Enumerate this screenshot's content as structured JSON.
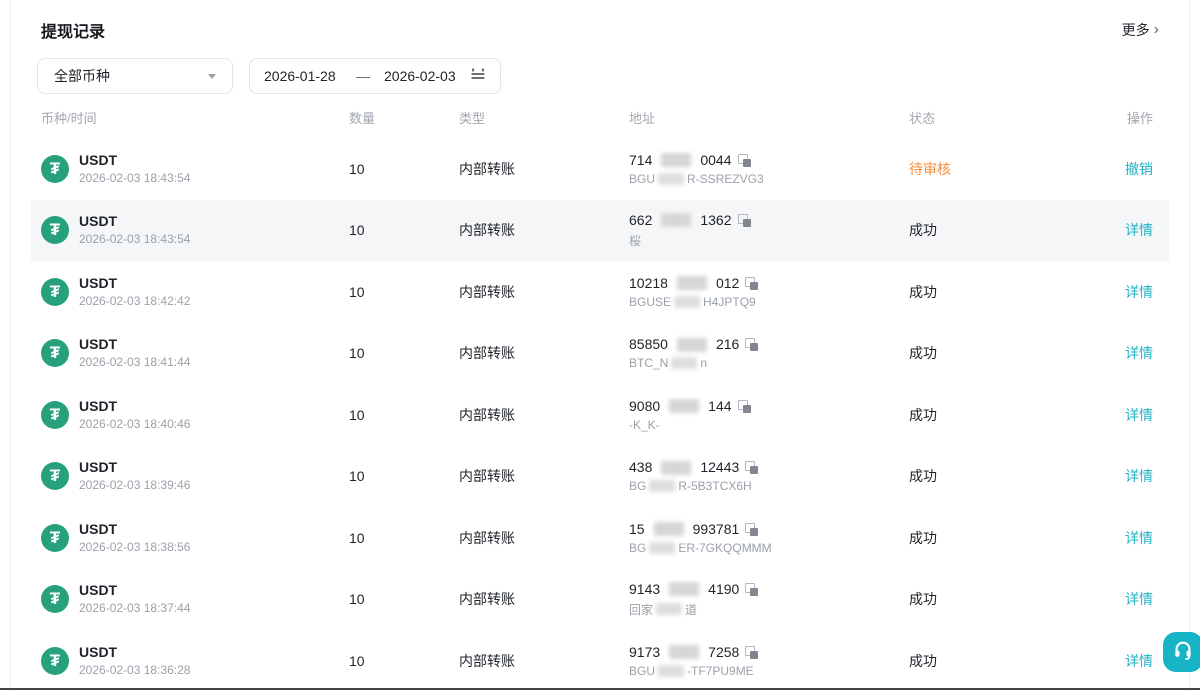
{
  "page": {
    "title": "提现记录",
    "more_label": "更多",
    "more_chevron": "›"
  },
  "filters": {
    "coin_select_value": "全部币种",
    "date_start": "2026-01-28",
    "date_separator": "—",
    "date_end": "2026-02-03"
  },
  "icons": {
    "coin": "tether-icon",
    "coin_glyph": "₮",
    "dropdown": "chevron-down-icon",
    "calendar": "calendar-icon",
    "copy": "copy-icon",
    "support": "headset-icon"
  },
  "colors": {
    "accent_teal": "#1fb3c7",
    "pending_orange": "#f78c3a",
    "tether_green": "#26a17b",
    "support_button": "#17b3c6",
    "row_highlight": "#f5f6f8"
  },
  "table": {
    "headers": [
      "币种/时间",
      "数量",
      "类型",
      "地址",
      "状态",
      "操作"
    ],
    "rows": [
      {
        "coin": "USDT",
        "time": "2026-02-03 18:43:54",
        "amount": "10",
        "type": "内部转账",
        "addr_prefix": "714",
        "addr_suffix": "0044",
        "sub_prefix": "BGU",
        "sub_suffix": "R-SSREZVG3",
        "sub_blurred": true,
        "status": "待审核",
        "status_type": "pending",
        "action": "撤销",
        "highlighted": false
      },
      {
        "coin": "USDT",
        "time": "2026-02-03 18:43:54",
        "amount": "10",
        "type": "内部转账",
        "addr_prefix": "662",
        "addr_suffix": "1362",
        "sub_prefix": "桜",
        "sub_suffix": "",
        "sub_blurred": false,
        "status": "成功",
        "status_type": "success",
        "action": "详情",
        "highlighted": true
      },
      {
        "coin": "USDT",
        "time": "2026-02-03 18:42:42",
        "amount": "10",
        "type": "内部转账",
        "addr_prefix": "10218",
        "addr_suffix": "012",
        "sub_prefix": "BGUSE",
        "sub_suffix": "H4JPTQ9",
        "sub_blurred": true,
        "status": "成功",
        "status_type": "success",
        "action": "详情",
        "highlighted": false
      },
      {
        "coin": "USDT",
        "time": "2026-02-03 18:41:44",
        "amount": "10",
        "type": "内部转账",
        "addr_prefix": "85850",
        "addr_suffix": "216",
        "sub_prefix": "BTC_N",
        "sub_suffix": "n",
        "sub_blurred": true,
        "status": "成功",
        "status_type": "success",
        "action": "详情",
        "highlighted": false
      },
      {
        "coin": "USDT",
        "time": "2026-02-03 18:40:46",
        "amount": "10",
        "type": "内部转账",
        "addr_prefix": "9080",
        "addr_suffix": "144",
        "sub_prefix": "-K_K-",
        "sub_suffix": "",
        "sub_blurred": false,
        "status": "成功",
        "status_type": "success",
        "action": "详情",
        "highlighted": false
      },
      {
        "coin": "USDT",
        "time": "2026-02-03 18:39:46",
        "amount": "10",
        "type": "内部转账",
        "addr_prefix": "438",
        "addr_suffix": "12443",
        "sub_prefix": "BG",
        "sub_suffix": "R-5B3TCX6H",
        "sub_blurred": true,
        "status": "成功",
        "status_type": "success",
        "action": "详情",
        "highlighted": false
      },
      {
        "coin": "USDT",
        "time": "2026-02-03 18:38:56",
        "amount": "10",
        "type": "内部转账",
        "addr_prefix": "15",
        "addr_suffix": "993781",
        "sub_prefix": "BG",
        "sub_suffix": "ER-7GKQQMMM",
        "sub_blurred": true,
        "status": "成功",
        "status_type": "success",
        "action": "详情",
        "highlighted": false
      },
      {
        "coin": "USDT",
        "time": "2026-02-03 18:37:44",
        "amount": "10",
        "type": "内部转账",
        "addr_prefix": "9143",
        "addr_suffix": "4190",
        "sub_prefix": "回家",
        "sub_suffix": "道",
        "sub_blurred": true,
        "status": "成功",
        "status_type": "success",
        "action": "详情",
        "highlighted": false
      },
      {
        "coin": "USDT",
        "time": "2026-02-03 18:36:28",
        "amount": "10",
        "type": "内部转账",
        "addr_prefix": "9173",
        "addr_suffix": "7258",
        "sub_prefix": "BGU",
        "sub_suffix": "-TF7PU9ME",
        "sub_blurred": true,
        "status": "成功",
        "status_type": "success",
        "action": "详情",
        "highlighted": false
      }
    ]
  }
}
